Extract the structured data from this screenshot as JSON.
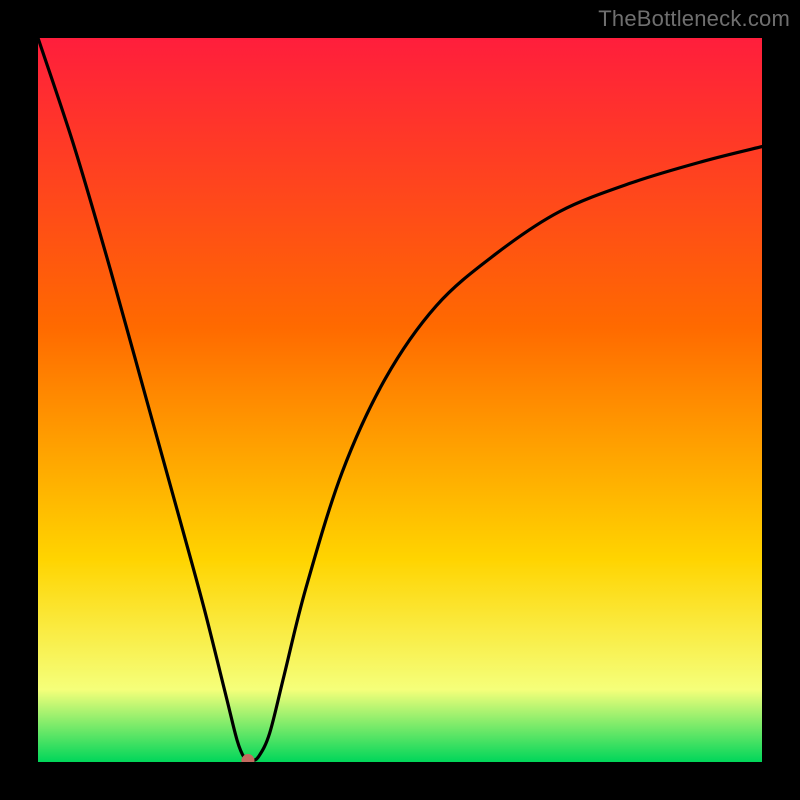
{
  "watermark": "TheBottleneck.com",
  "chart_data": {
    "type": "line",
    "title": "",
    "xlabel": "",
    "ylabel": "",
    "xlim": [
      0,
      100
    ],
    "ylim": [
      0,
      100
    ],
    "grid": false,
    "legend": false,
    "background_gradient": [
      "#ff1e3c",
      "#ff6a00",
      "#ffd400",
      "#f5ff7a",
      "#00d65a"
    ],
    "optimum_x": 29,
    "optimum_y": 0,
    "series": [
      {
        "name": "bottleneck-curve",
        "x": [
          0,
          5,
          10,
          15,
          20,
          23,
          26,
          27.5,
          28.5,
          29.5,
          30.5,
          32,
          34,
          37,
          42,
          48,
          55,
          63,
          72,
          82,
          92,
          100
        ],
        "y": [
          100,
          85,
          68,
          50,
          32,
          21,
          9,
          3,
          0.6,
          0.2,
          0.8,
          4,
          12,
          24,
          40,
          53,
          63,
          70,
          76,
          80,
          83,
          85
        ]
      }
    ],
    "marker": {
      "x": 29,
      "y": 0.2,
      "color": "#c46a5f",
      "radius_pct": 0.9
    }
  }
}
